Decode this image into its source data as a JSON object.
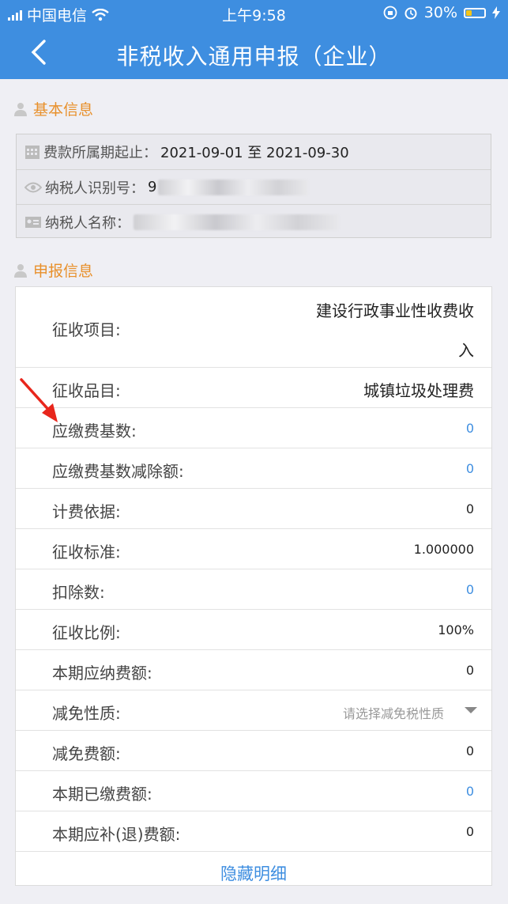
{
  "status_bar": {
    "carrier": "中国电信",
    "time": "上午9:58",
    "battery": "30%",
    "battery_level": 0.3
  },
  "navbar": {
    "title": "非税收入通用申报（企业）"
  },
  "basic_info": {
    "heading": "基本信息",
    "period_label": "费款所属期起止：",
    "period_value": "2021-09-01 至 2021-09-30",
    "taxpayer_id_label": "纳税人识别号：",
    "taxpayer_id_value": "9",
    "taxpayer_name_label": "纳税人名称："
  },
  "declaration": {
    "heading": "申报信息",
    "rows": [
      {
        "label": "征收项目:",
        "value_line1": "建设行政事业性收费收",
        "value_line2": "入"
      },
      {
        "label": "征收品目:",
        "value": "城镇垃圾处理费"
      },
      {
        "label": "应缴费基数:",
        "value": "0"
      },
      {
        "label": "应缴费基数减除额:",
        "value": "0"
      },
      {
        "label": "计费依据:",
        "value": "0"
      },
      {
        "label": "征收标准:",
        "value": "1.000000"
      },
      {
        "label": "扣除数:",
        "value": "0"
      },
      {
        "label": "征收比例:",
        "value": "100%"
      },
      {
        "label": "本期应纳费额:",
        "value": "0"
      },
      {
        "label": "减免性质:",
        "placeholder": "请选择减免税性质"
      },
      {
        "label": "减免费额:",
        "value": "0"
      },
      {
        "label": "本期已缴费额:",
        "value": "0"
      },
      {
        "label": "本期应补(退)费额:",
        "value": "0"
      }
    ],
    "hide_details": "隐藏明细"
  },
  "colors": {
    "primary": "#3e8ee0",
    "section": "#e8902b",
    "annotation_arrow": "#e8261c"
  }
}
